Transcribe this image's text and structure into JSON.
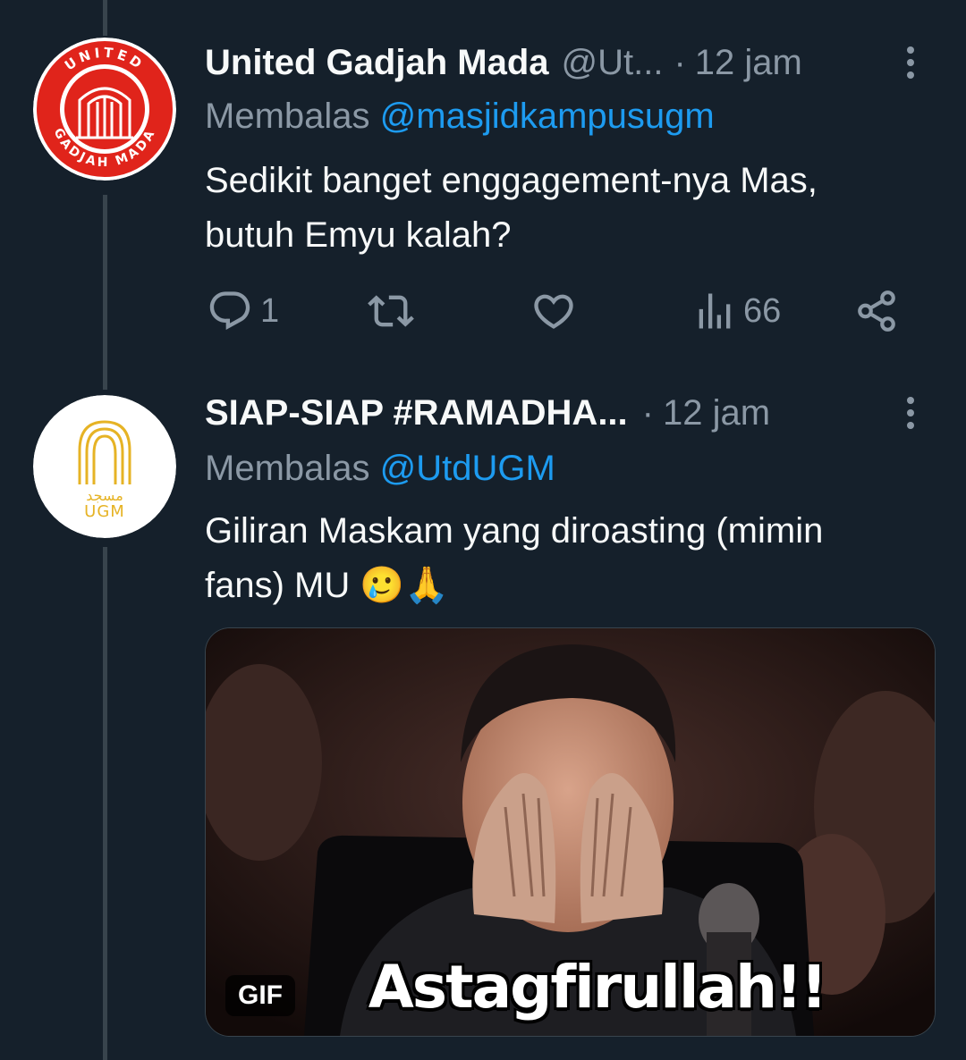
{
  "thread": [
    {
      "avatar": {
        "name": "united-gadjah-mada-logo",
        "ring_text_top": "UNITED",
        "ring_text_bottom": "GADJAH MADA",
        "color": "#e0241b"
      },
      "display_name": "United Gadjah Mada",
      "handle": "@Ut...",
      "separator": "·",
      "time": "12 jam",
      "replying_prefix": "Membalas",
      "replying_to": "@masjidkampusugm",
      "text_lines": [
        "Sedikit banget enggagement-nya Mas,",
        "butuh Emyu kalah?"
      ],
      "actions": {
        "replies": "1",
        "retweets": "",
        "likes": "",
        "views": "66"
      }
    },
    {
      "avatar": {
        "name": "masjid-ugm-logo",
        "arabic": "مسجد",
        "latin": "UGM",
        "color": "#e6b325"
      },
      "display_name": "SIAP-SIAP #RAMADHA...",
      "handle": "",
      "separator": "·",
      "time": "12 jam",
      "replying_prefix": "Membalas",
      "replying_to": "@UtdUGM",
      "text_lines": [
        "Giliran Maskam yang diroasting (mimin",
        "fans) MU"
      ],
      "emojis": [
        "🥲",
        "🙏"
      ],
      "media": {
        "type": "gif",
        "badge": "GIF",
        "caption": "Astagfirullah!!"
      }
    }
  ],
  "colors": {
    "background": "#15202b",
    "text": "#f7f9f9",
    "muted": "#8b98a5",
    "link": "#1d9bf0",
    "line": "#38444d"
  },
  "icons": [
    "reply-icon",
    "retweet-icon",
    "like-icon",
    "views-icon",
    "share-icon",
    "more-icon"
  ]
}
